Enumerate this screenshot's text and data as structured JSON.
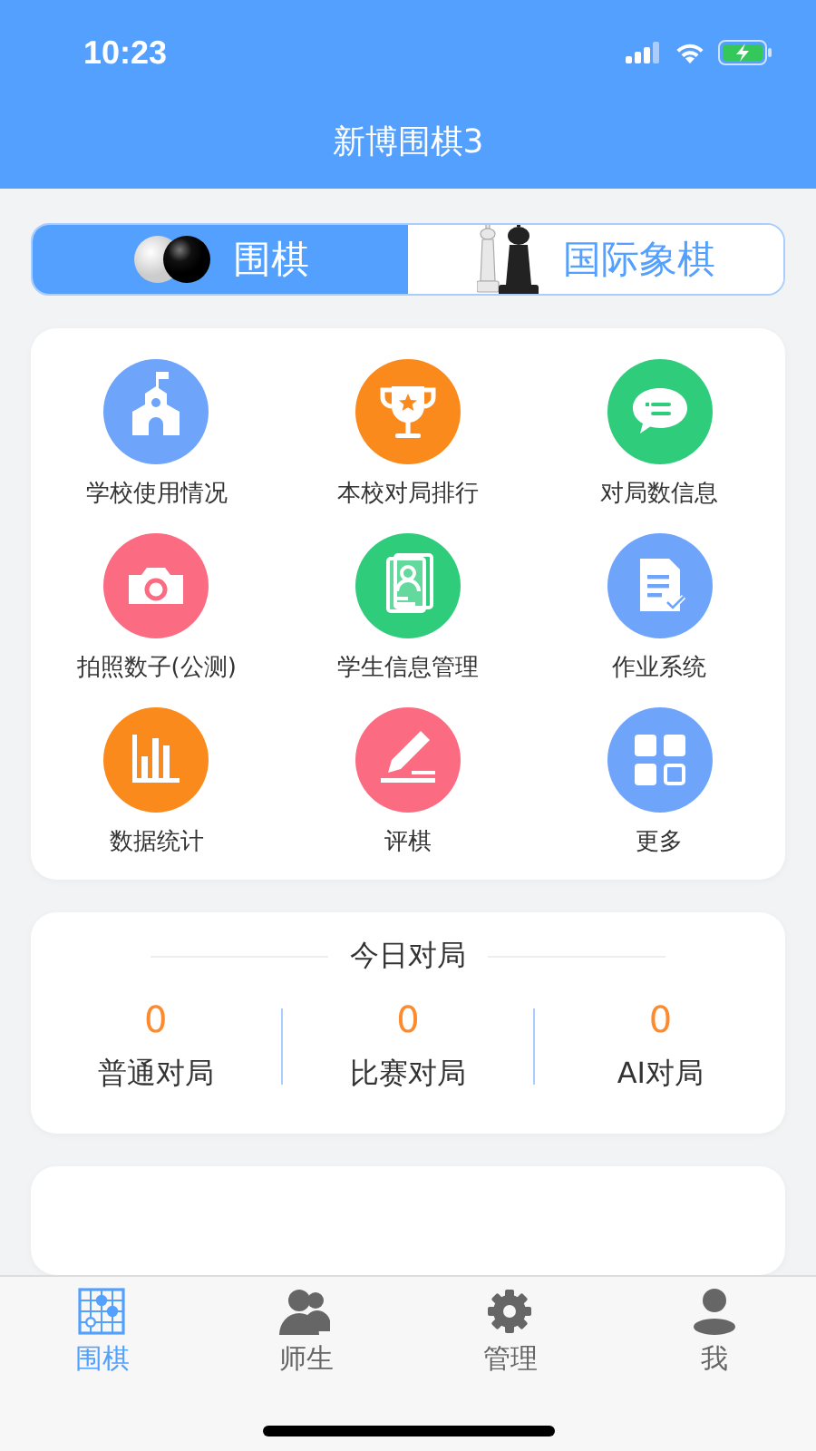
{
  "status_bar": {
    "time": "10:23"
  },
  "header": {
    "title": "新博围棋3"
  },
  "game_tabs": [
    {
      "label": "围棋",
      "selected": true,
      "kind": "go"
    },
    {
      "label": "国际象棋",
      "selected": false,
      "kind": "chess"
    }
  ],
  "features": [
    {
      "label": "学校使用情况",
      "kind": "school",
      "color": "#6fa4fb"
    },
    {
      "label": "本校对局排行",
      "kind": "trophy",
      "color": "#fb8a1c"
    },
    {
      "label": "对局数信息",
      "kind": "chat",
      "color": "#2fcc7c"
    },
    {
      "label": "拍照数子(公测)",
      "kind": "camera",
      "color": "#fb6c82"
    },
    {
      "label": "学生信息管理",
      "kind": "card",
      "color": "#2fcc7c"
    },
    {
      "label": "作业系统",
      "kind": "document",
      "color": "#6fa4fb"
    },
    {
      "label": "数据统计",
      "kind": "bars",
      "color": "#fb8a1c"
    },
    {
      "label": "评棋",
      "kind": "pencil",
      "color": "#fb6c82"
    },
    {
      "label": "更多",
      "kind": "grid",
      "color": "#6fa4fb"
    }
  ],
  "today": {
    "title": "今日对局",
    "stats": [
      {
        "value": "0",
        "label": "普通对局"
      },
      {
        "value": "0",
        "label": "比赛对局"
      },
      {
        "value": "0",
        "label": "AI对局"
      }
    ]
  },
  "tab_bar": [
    {
      "label": "围棋",
      "selected": true,
      "kind": "board"
    },
    {
      "label": "师生",
      "selected": false,
      "kind": "people"
    },
    {
      "label": "管理",
      "selected": false,
      "kind": "gear"
    },
    {
      "label": "我",
      "selected": false,
      "kind": "person"
    }
  ]
}
